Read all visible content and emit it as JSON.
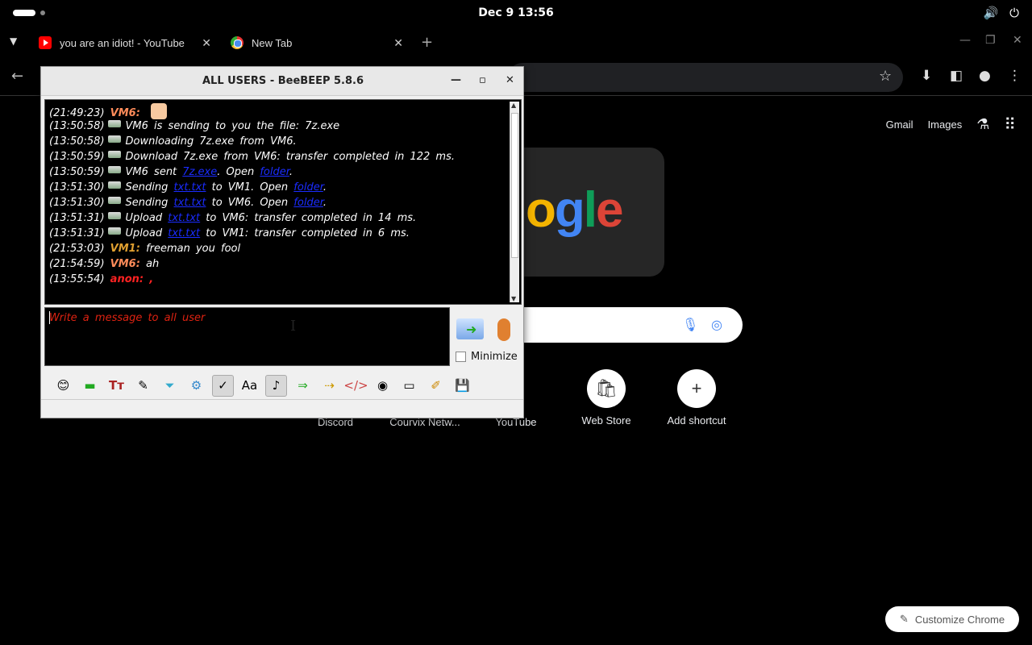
{
  "topbar": {
    "clock": "Dec 9  13:56",
    "volume_icon": "volume-icon",
    "power_icon": "power-icon"
  },
  "browser": {
    "tabs": [
      {
        "title": "you are an idiot! - YouTube",
        "icon": "youtube-icon"
      },
      {
        "title": "New Tab",
        "icon": "chrome-icon"
      }
    ],
    "ntp": {
      "gmail": "Gmail",
      "images": "Images",
      "doodle_text": "ogle",
      "shortcuts": [
        "Discord",
        "Courvix Netw...",
        "YouTube",
        "Web Store",
        "Add shortcut"
      ],
      "customize": "Customize Chrome"
    }
  },
  "beebeep": {
    "title": "ALL USERS - BeeBEEP 5.8.6",
    "messages": [
      {
        "ts": "(21:49:23)",
        "user": "VM6:",
        "text": ""
      },
      {
        "ts": "(13:50:58)",
        "text": "VM6 is sending to you the file: 7z.exe"
      },
      {
        "ts": "(13:50:58)",
        "text": "Downloading 7z.exe from VM6."
      },
      {
        "ts": "(13:50:59)",
        "text": "Download 7z.exe from VM6: transfer completed in 122 ms."
      },
      {
        "ts": "(13:50:59)",
        "pre": "VM6 sent",
        "link": "7z.exe",
        "mid": ". Open",
        "link2": "folder",
        "post": "."
      },
      {
        "ts": "(13:51:30)",
        "pre": "Sending",
        "link": "txt.txt",
        "mid": "to VM1. Open",
        "link2": "folder",
        "post": "."
      },
      {
        "ts": "(13:51:30)",
        "pre": "Sending",
        "link": "txt.txt",
        "mid": "to VM6. Open",
        "link2": "folder",
        "post": "."
      },
      {
        "ts": "(13:51:31)",
        "pre": "Upload",
        "link": "txt.txt",
        "mid": "to VM6: transfer completed in 14 ms."
      },
      {
        "ts": "(13:51:31)",
        "pre": "Upload",
        "link": "txt.txt",
        "mid": "to VM1: transfer completed in 6 ms."
      },
      {
        "ts": "(21:53:03)",
        "user": "VM1:",
        "text": "freeman you fool"
      },
      {
        "ts": "(21:54:59)",
        "user": "VM6:",
        "text": "ah"
      },
      {
        "ts": "(13:55:54)",
        "user": "anon:",
        "text": ","
      }
    ],
    "input_placeholder": "Write a message to all user",
    "minimize_label": "Minimize"
  }
}
